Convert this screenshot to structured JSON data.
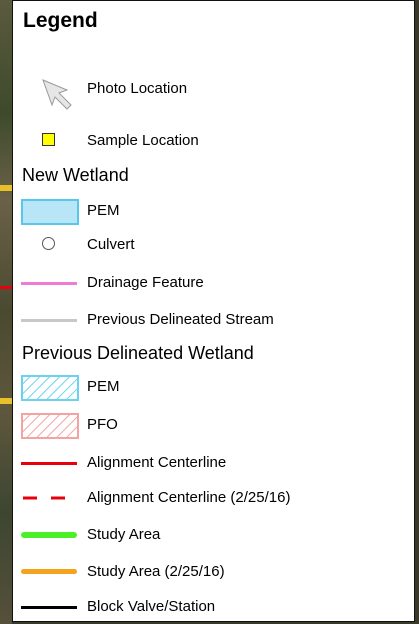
{
  "legend": {
    "title": "Legend",
    "photo_location": "Photo Location",
    "sample_location": "Sample Location",
    "new_wetland_heading": "New Wetland",
    "new_pem": "PEM",
    "culvert": "Culvert",
    "drainage_feature": "Drainage Feature",
    "previous_stream": "Previous Delineated Stream",
    "previous_wetland_heading": "Previous Delineated Wetland",
    "prev_pem": "PEM",
    "prev_pfo": "PFO",
    "alignment_centerline": "Alignment Centerline",
    "alignment_centerline_old": "Alignment Centerline (2/25/16)",
    "study_area": "Study Area",
    "study_area_old": "Study Area (2/25/16)",
    "block_valve": "Block Valve/Station"
  },
  "colors": {
    "sample_fill": "#ffff00",
    "new_pem_fill": "#b9e6f7",
    "new_pem_border": "#58c7ec",
    "drainage": "#f07bd4",
    "previous_stream": "#c8c8c8",
    "prev_pem_hatch": "#6dd2f0",
    "prev_pfo_hatch": "#f4a3a3",
    "alignment": "#e8000b",
    "study_area": "#4cf029",
    "study_area_old": "#f5a21c",
    "block_valve": "#000000"
  },
  "icons": {
    "photo_location": "arrow-pointer-icon",
    "sample_location": "yellow-square-icon",
    "culvert": "circle-outline-icon"
  }
}
